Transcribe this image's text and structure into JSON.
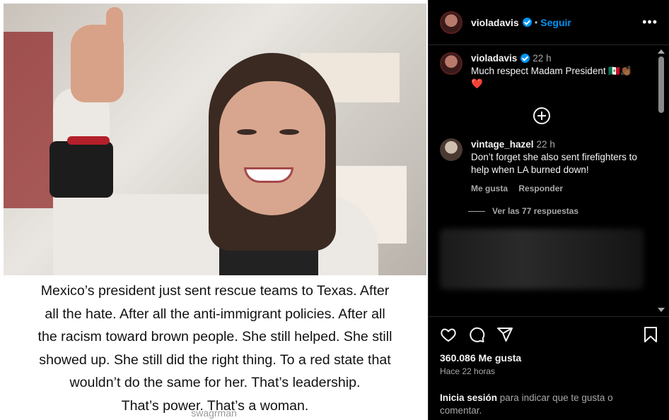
{
  "post": {
    "caption_lines": [
      "Mexico’s president just sent rescue teams to Texas. After",
      "all the hate. After all the anti-immigrant policies. After all",
      "the racism toward brown people. She still helped. She still",
      "showed up. She still did the right thing. To a red state that",
      "wouldn’t do the same for her. That’s leadership.",
      "That’s power. That’s a woman."
    ],
    "watermark": "swagrman"
  },
  "header": {
    "username": "violadavis",
    "dot": "•",
    "follow_label": "Seguir",
    "more_label": "•••"
  },
  "comments": [
    {
      "username": "violadavis",
      "time": "22 h",
      "text": "Much respect Madam President 🇲🇽👏🏾",
      "emoji_line": "❤️"
    },
    {
      "username": "vintage_hazel",
      "time": "22 h",
      "text": "Don’t forget she also sent firefighters to help when LA burned down!",
      "like_label": "Me gusta",
      "reply_label": "Responder",
      "view_replies": "Ver las 77 respuestas"
    }
  ],
  "footer": {
    "likes": "360.086 Me gusta",
    "time_ago": "Hace 22 horas",
    "login_link": "Inicia sesión",
    "login_text": " para indicar que te gusta o comentar."
  },
  "colors": {
    "accent": "#0095f6",
    "background": "#000000",
    "muted": "#a8a8a8"
  },
  "icons": [
    "heart-icon",
    "comment-icon",
    "share-icon",
    "bookmark-icon",
    "plus-circle-icon",
    "verified-icon",
    "more-icon"
  ]
}
